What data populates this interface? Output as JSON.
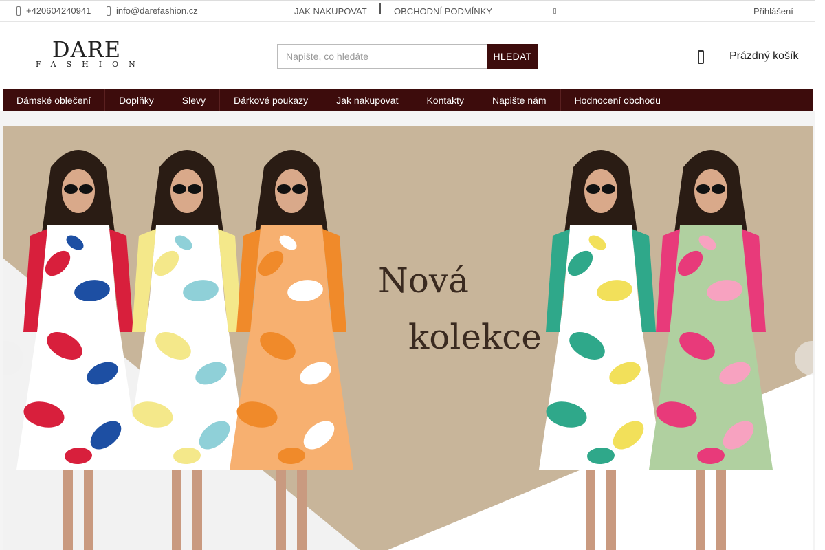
{
  "topbar": {
    "phone": "+420604240941",
    "email": "info@darefashion.cz",
    "links": [
      "JAK NAKUPOVAT",
      "OBCHODNÍ PODMÍNKY"
    ],
    "login": "Přihlášení"
  },
  "header": {
    "logo_top": "DARE",
    "logo_bottom": "FASHION",
    "search_placeholder": "Napište, co hledáte",
    "search_button": "HLEDAT",
    "cart_label": "Prázdný košík"
  },
  "nav": {
    "items": [
      "Dámské oblečení",
      "Doplňky",
      "Slevy",
      "Dárkové poukazy",
      "Jak nakupovat",
      "Kontakty",
      "Napište nám",
      "Hodnocení obchodu"
    ]
  },
  "hero": {
    "line1": "Nová",
    "line2": "kolekce",
    "colors": {
      "background": "#c8b59a",
      "white_shape": "#ffffff",
      "nav": "#3d0c0c"
    },
    "dresses": [
      {
        "colors": [
          "#d81f3c",
          "#1d4fa3",
          "#ffffff"
        ]
      },
      {
        "colors": [
          "#f4e88a",
          "#8fd0d8",
          "#ffffff"
        ]
      },
      {
        "colors": [
          "#f08a2a",
          "#ffffff",
          "#f7b070"
        ]
      },
      {
        "colors": [
          "#2fa88a",
          "#f2e05a",
          "#ffffff"
        ]
      },
      {
        "colors": [
          "#e83a7a",
          "#f7a2c0",
          "#b0d0a0"
        ]
      }
    ]
  }
}
